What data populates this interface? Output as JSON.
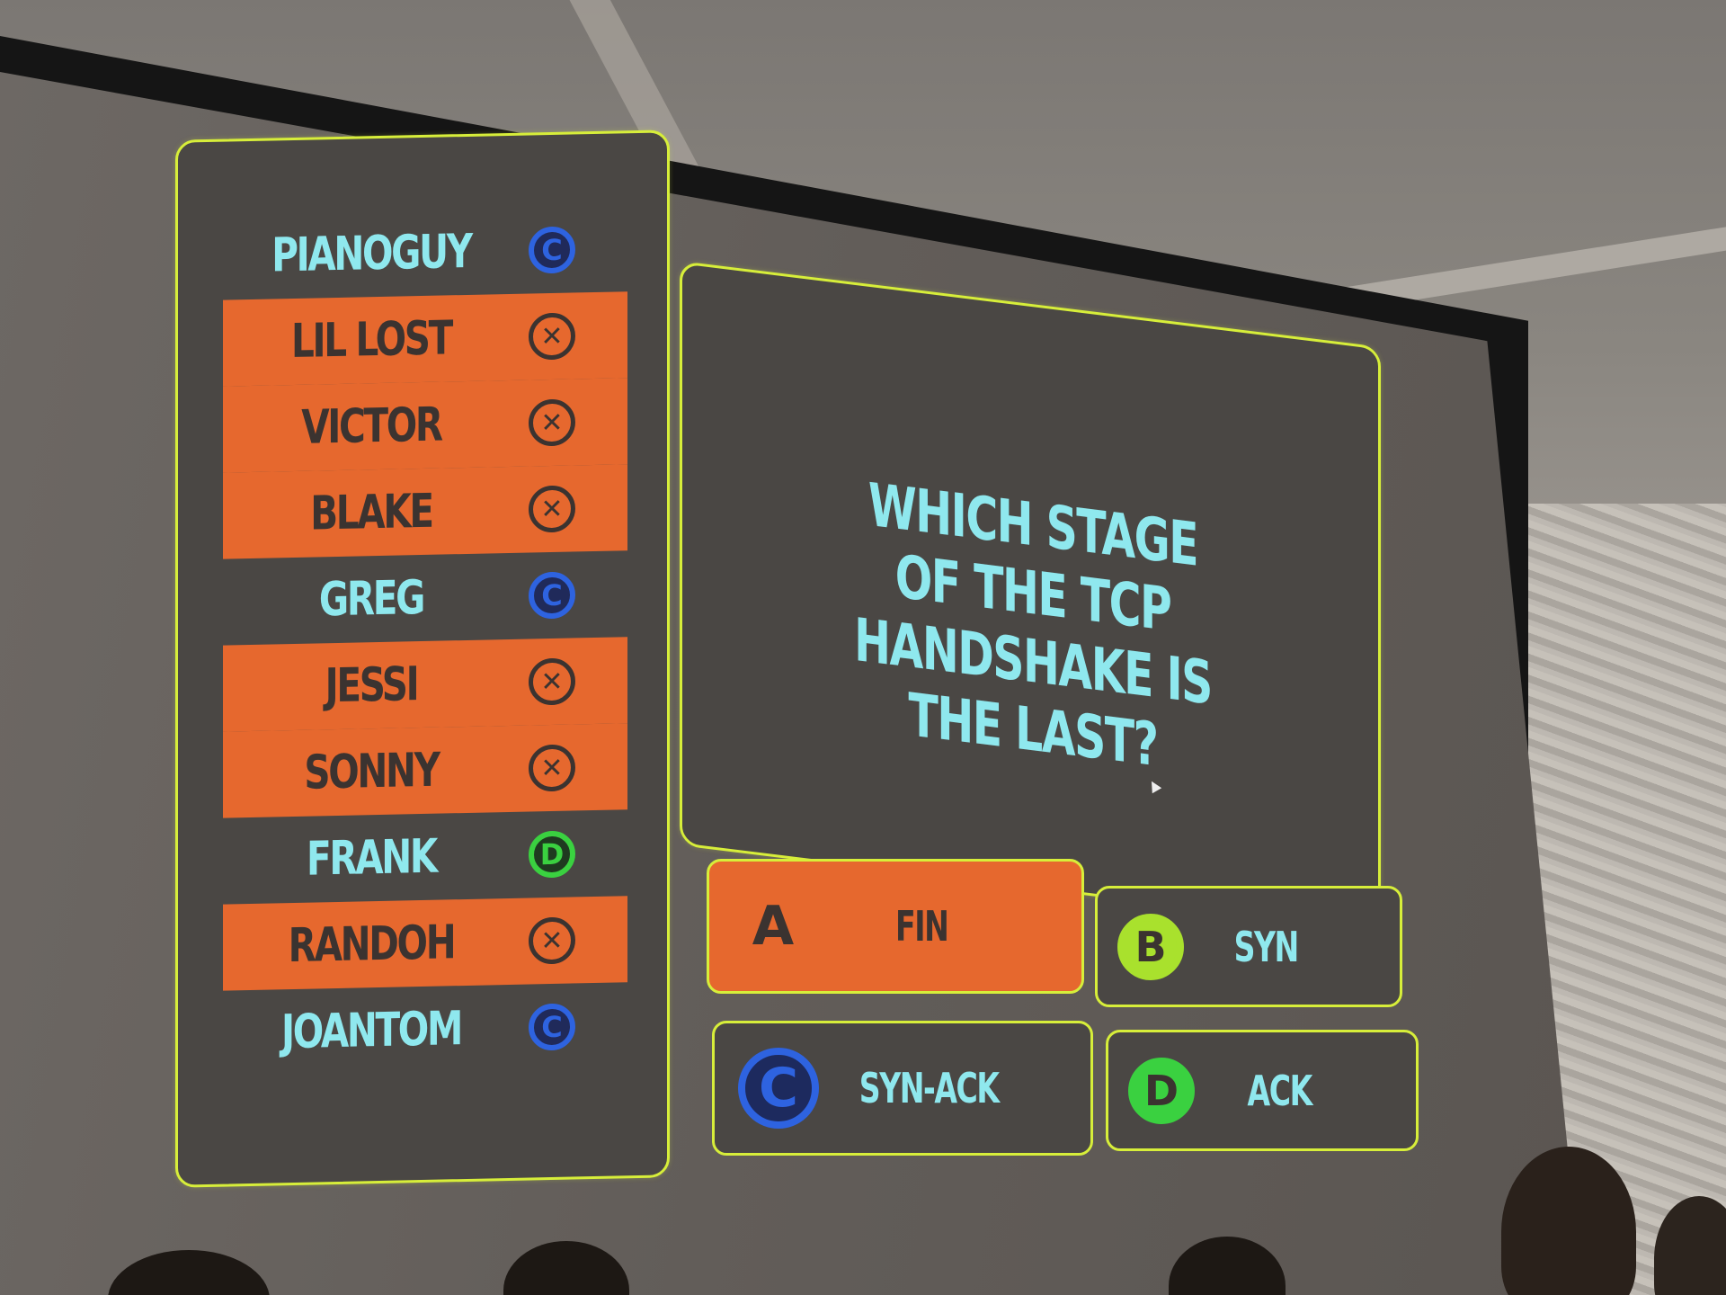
{
  "players": [
    {
      "name": "PIANOGUY",
      "status": "answered",
      "answer": "C"
    },
    {
      "name": "LIL LOST",
      "status": "wrong",
      "answer": "X"
    },
    {
      "name": "VICTOR",
      "status": "wrong",
      "answer": "X"
    },
    {
      "name": "BLAKE",
      "status": "wrong",
      "answer": "X"
    },
    {
      "name": "GREG",
      "status": "answered",
      "answer": "C"
    },
    {
      "name": "JESSI",
      "status": "wrong",
      "answer": "X"
    },
    {
      "name": "SONNY",
      "status": "wrong",
      "answer": "X"
    },
    {
      "name": "FRANK",
      "status": "answered",
      "answer": "D"
    },
    {
      "name": "RANDOH",
      "status": "wrong",
      "answer": "X"
    },
    {
      "name": "JOANTOM",
      "status": "answered",
      "answer": "C"
    }
  ],
  "question": {
    "text": "WHICH STAGE OF THE TCP HANDSHAKE IS THE LAST?"
  },
  "answers": [
    {
      "letter": "A",
      "text": "FIN",
      "selected": true
    },
    {
      "letter": "B",
      "text": "SYN",
      "selected": false
    },
    {
      "letter": "C",
      "text": "SYN-ACK",
      "selected": false
    },
    {
      "letter": "D",
      "text": "ACK",
      "selected": false
    }
  ],
  "colors": {
    "panel_border": "#d7ee3a",
    "wrong_highlight": "#e6682e",
    "name_text": "#8fe8ee",
    "answer_c": "#2e63e0",
    "answer_d": "#3ad140",
    "answer_b": "#a9e12d"
  },
  "icons": {
    "wrong": "x-circle-icon",
    "answer_c": "letter-c-badge-icon",
    "answer_d": "letter-d-badge-icon"
  }
}
